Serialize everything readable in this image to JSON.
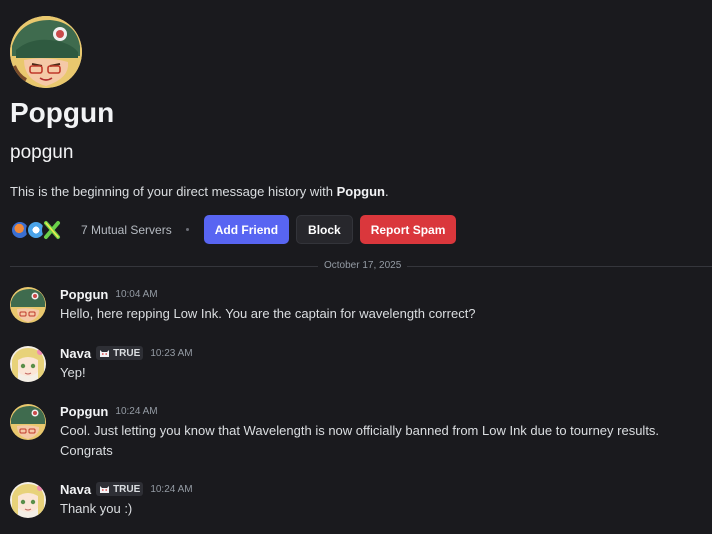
{
  "profile": {
    "display_name": "Popgun",
    "username": "popgun",
    "intro_prefix": "This is the beginning of your direct message history with ",
    "intro_name": "Popgun",
    "intro_suffix": ".",
    "avatar": "popgun-avatar"
  },
  "actions": {
    "mutual_servers": "7 Mutual Servers",
    "add_friend": "Add Friend",
    "block": "Block",
    "report_spam": "Report Spam"
  },
  "divider": {
    "date": "October 17, 2025"
  },
  "messages": [
    {
      "author": "Popgun",
      "time": "10:04 AM",
      "text": "Hello, here repping Low Ink. You are the captain for wavelength correct?",
      "avatar": "popgun-avatar"
    },
    {
      "author": "Nava",
      "tag": "TRUE",
      "time": "10:23 AM",
      "text": "Yep!",
      "avatar": "nava-avatar"
    },
    {
      "author": "Popgun",
      "time": "10:24 AM",
      "text": "Cool. Just letting you know that Wavelength is now officially banned from Low Ink due to tourney results. Congrats",
      "avatar": "popgun-avatar"
    },
    {
      "author": "Nava",
      "tag": "TRUE",
      "time": "10:24 AM",
      "text": "Thank you :)",
      "avatar": "nava-avatar"
    }
  ],
  "colors": {
    "background": "#1a1a1e",
    "blurple": "#5865f2",
    "danger": "#da373c"
  }
}
